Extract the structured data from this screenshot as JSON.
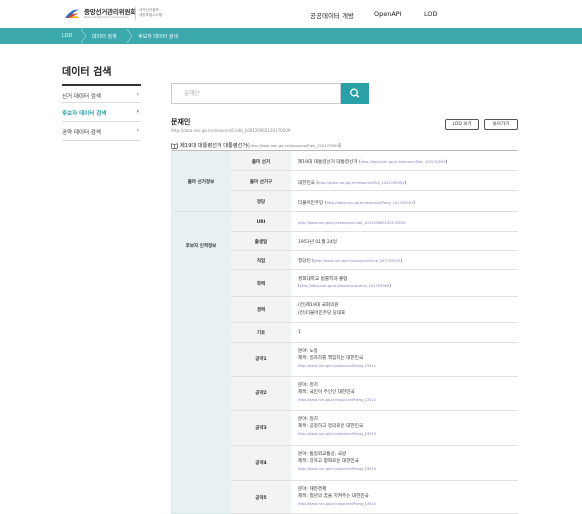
{
  "header": {
    "logo_main": "중앙선거관리위원회",
    "logo_sub": "National Election Commission",
    "logo_side_line1": "국가선거정보",
    "logo_side_line2": "개방포털시스템",
    "nav": [
      "공공데이터 개방",
      "OpenAPI",
      "LOD"
    ]
  },
  "breadcrumb": [
    "LOD",
    "데이터 검색",
    "후보자 데이터 검색"
  ],
  "page_title": "데이터 검색",
  "side_menu": [
    {
      "label": "선거 데이터 검색"
    },
    {
      "label": "후보자 데이터 검색"
    },
    {
      "label": "공약 데이터 검색"
    }
  ],
  "search": {
    "placeholder": "문재인",
    "value": ""
  },
  "person": {
    "name": "문재인",
    "uri": "http://data.nec.go.kr/resource/Cndd_100120965120170509",
    "lod_button": "LOD 보기",
    "back_button": "돌아가기"
  },
  "election": {
    "title": "제19대 대통령선거 대통령선거",
    "uri": "http://data.nec.go.kr/resource/Elec_120170509"
  },
  "groups": {
    "election_info": "출마 선거정보",
    "personal_info": "후보자 인적정보"
  },
  "rows": {
    "r1": {
      "label": "출마 선거",
      "value": "제19대 대통령선거 대통령선거",
      "uri": "http://data.nec.go.kr/resource/Elec_120170509"
    },
    "r2": {
      "label": "출마 선거구",
      "value": "대한민국",
      "uri": "http://data.nec.go.kr/resource/Elct_1201705091"
    },
    "r3": {
      "label": "정당",
      "value": "더불어민주당",
      "uri": "http://data.nec.go.kr/resource/Party_201705091"
    },
    "r4": {
      "label": "URI",
      "value": "http://data.nec.go.kr/resource/Cndd_100120965120170509"
    },
    "r5": {
      "label": "출생일",
      "value": "1953년 01월 24일"
    },
    "r6": {
      "label": "직업",
      "value": "정당인",
      "uri": "http://data.nec.go.kr/resource/Occp_201705970"
    },
    "r7": {
      "label": "학력",
      "value": "경희대학교 법률학과 졸업",
      "uri": "http://data.nec.go.kr/resource/Acdmc_201705969"
    },
    "r8": {
      "label": "경력",
      "line1": "(전)제19대 국회의원",
      "line2": "(전)더불어민주당 당대표"
    },
    "r9": {
      "label": "기호",
      "value": "1"
    }
  },
  "pledges": [
    {
      "label": "공약1",
      "area": "분야: 노동",
      "title": "제목: 일자리를 책임지는 대한민국",
      "uri": "http://data.nec.go.kr/resource/Pvldg_13511"
    },
    {
      "label": "공약2",
      "area": "분야: 정치",
      "title": "제목: 국민이 주인인 대한민국",
      "uri": "http://data.nec.go.kr/resource/Pvldg_13512"
    },
    {
      "label": "공약3",
      "area": "분야: 정치",
      "title": "제목: 공정하고 정의로운 대한민국",
      "uri": "http://data.nec.go.kr/resource/Pvldg_13513"
    },
    {
      "label": "공약4",
      "area": "분야: 통일외교통상, 국방",
      "title": "제목: 강하고 평화로운 대한민국",
      "uri": "http://data.nec.go.kr/resource/Pvldg_13514"
    },
    {
      "label": "공약5",
      "area": "분야: 재정경제",
      "title": "제목: 청년의 꿈을 지켜주는 대한민국",
      "uri": "http://data.nec.go.kr/resource/Pvldg_13515"
    }
  ],
  "colors": {
    "teal": "#3aa8ac",
    "teal_dark": "#2aa0a6",
    "link": "#7a7fb8"
  }
}
